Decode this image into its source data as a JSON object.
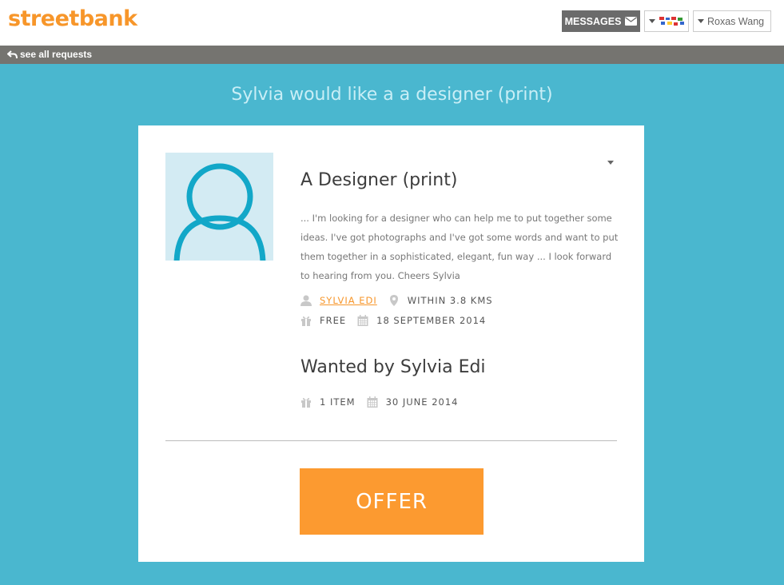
{
  "header": {
    "logo": "streetbank",
    "messages_label": "MESSAGES",
    "user_name": "Roxas Wang"
  },
  "subbar": {
    "back_label": "see all requests"
  },
  "page": {
    "title": "Sylvia would like a a designer (print)"
  },
  "item": {
    "title": "A Designer (print)",
    "description": "... I'm looking for a designer who can help me to put together some ideas. I've got photographs and I've got some words and want to put them together in a sophisticated, elegant, fun way ... I look forward to hearing from you. Cheers Sylvia",
    "owner": "SYLVIA EDI",
    "distance": "WITHIN 3.8 KMS",
    "price": "FREE",
    "date": "18 SEPTEMBER 2014"
  },
  "wanted": {
    "title": "Wanted by Sylvia Edi",
    "count": "1 ITEM",
    "date": "30 JUNE 2014"
  },
  "offer_label": "OFFER",
  "colors": {
    "brand": "#f7962a",
    "background": "#4ab7cf",
    "offer": "#fc9a30",
    "avatar": "#12a7c8"
  },
  "icons": [
    "mail-icon",
    "caret-down-icon",
    "flag-icon",
    "back-arrow-icon",
    "user-icon",
    "map-pin-icon",
    "gift-icon",
    "calendar-icon"
  ]
}
